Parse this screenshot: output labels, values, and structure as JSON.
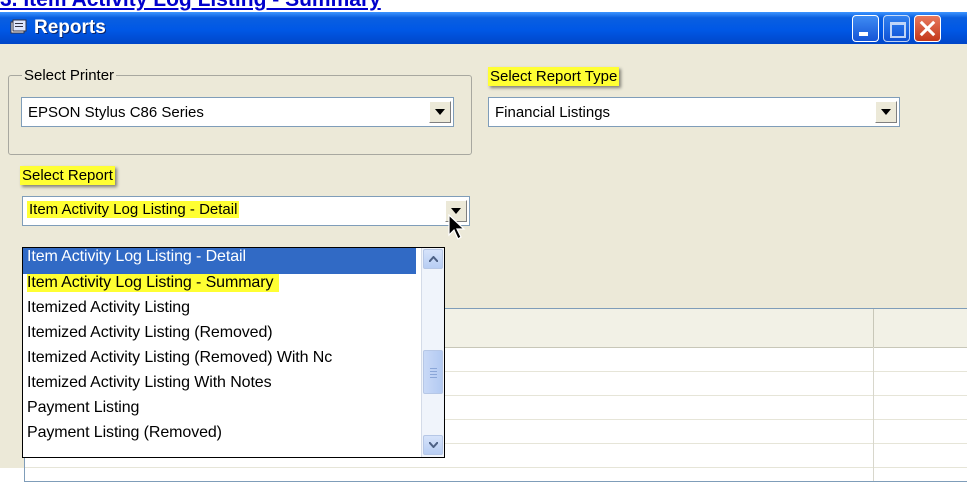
{
  "caption": {
    "text": "3. Item Activity Log Listing - Summary"
  },
  "window": {
    "title": "Reports",
    "icon": "reports-window-icon",
    "controls": [
      "minimize-icon",
      "maximize-icon",
      "close-icon"
    ]
  },
  "printer": {
    "label": "Select Printer",
    "value": "EPSON Stylus C86 Series"
  },
  "report_type": {
    "label": "Select Report Type",
    "value": "Financial Listings"
  },
  "report": {
    "label": "Select Report",
    "value": "Item Activity Log Listing - Detail",
    "options": [
      "Item Activity Log Listing - Detail",
      "Item Activity Log Listing - Summary",
      "Itemized Activity Listing",
      "Itemized Activity Listing (Removed)",
      "Itemized Activity Listing (Removed) With Nc",
      "Itemized Activity Listing With Notes",
      "Payment Listing",
      "Payment Listing (Removed)"
    ]
  },
  "colors": {
    "highlight": "#ffff33",
    "selection": "#316ac5",
    "titlebar": "#0058e6",
    "caption_link": "#0000cc"
  }
}
